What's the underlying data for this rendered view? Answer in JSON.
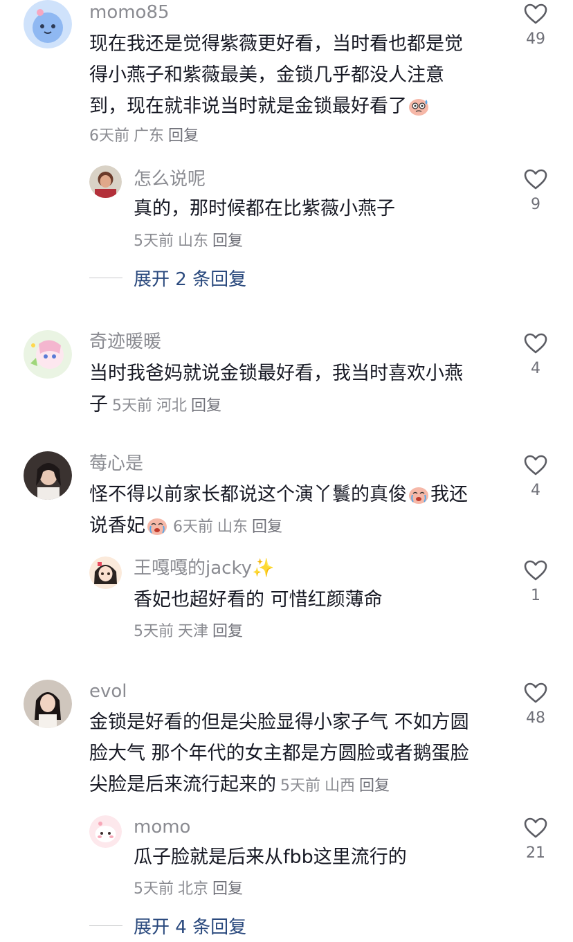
{
  "comments": [
    {
      "username": "momo85",
      "lines": [
        "现在我还是觉得紫薇更好看，当时看也都是觉",
        "得小燕子和紫薇最美，金锁几乎都没人注意",
        "到，现在就非说当时就是金锁最好看了"
      ],
      "time": "6天前",
      "location": "广东",
      "reply": "回复",
      "likes": "49",
      "replies": [
        {
          "username": "怎么说呢",
          "text": "真的，那时候都在比紫薇小燕子",
          "time": "5天前",
          "location": "山东",
          "reply": "回复",
          "likes": "9"
        }
      ],
      "expand": "展开 2 条回复"
    },
    {
      "username": "奇迹暖暖",
      "lines": [
        "当时我爸妈就说金锁最好看，我当时喜欢小燕",
        "子"
      ],
      "time": "5天前",
      "location": "河北",
      "reply": "回复",
      "likes": "4"
    },
    {
      "username": "莓心是",
      "lines": [
        "怪不得以前家长都说这个演丫鬟的真俊",
        "我还",
        "说香妃"
      ],
      "time": "6天前",
      "location": "山东",
      "reply": "回复",
      "likes": "4",
      "replies": [
        {
          "username": "王嘎嘎的jacky",
          "text": "香妃也超好看的 可惜红颜薄命",
          "time": "5天前",
          "location": "天津",
          "reply": "回复",
          "likes": "1"
        }
      ]
    },
    {
      "username": "evol",
      "lines": [
        "金锁是好看的但是尖脸显得小家子气 不如方圆",
        "脸大气 那个年代的女主都是方圆脸或者鹅蛋脸",
        "尖脸是后来流行起来的"
      ],
      "time": "5天前",
      "location": "山西",
      "reply": "回复",
      "likes": "48",
      "replies": [
        {
          "username": "momo",
          "text": "瓜子脸就是后来从fbb这里流行的",
          "time": "5天前",
          "location": "北京",
          "reply": "回复",
          "likes": "21"
        }
      ],
      "expand": "展开 4 条回复"
    }
  ],
  "icons": {
    "like": "heart-outline-icon",
    "emoji_1": "sweat-face-emoji",
    "emoji_2": "crying-face-emoji",
    "sparkle": "✨"
  },
  "colors": {
    "username": "#8a8b91",
    "text": "#161823",
    "meta": "#8a8b91",
    "expand": "#2b4a7e"
  }
}
